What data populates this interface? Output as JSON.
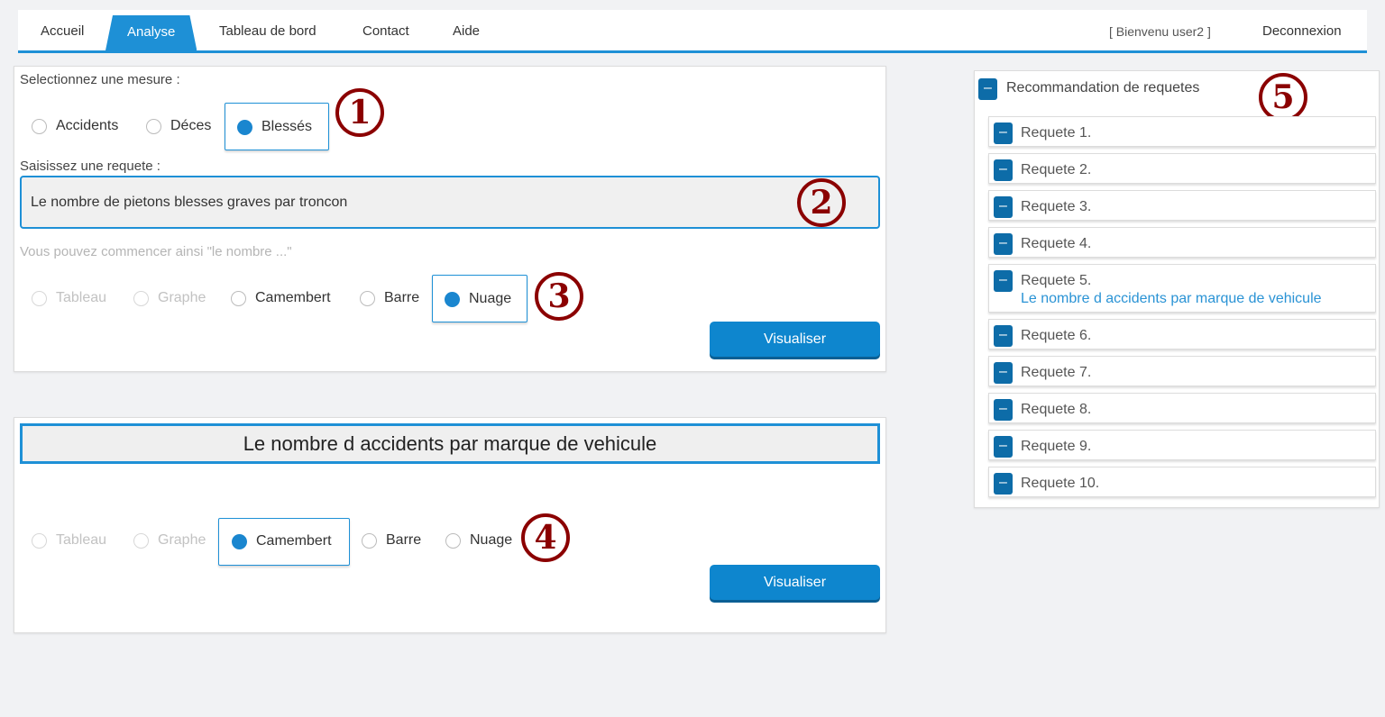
{
  "nav": {
    "tabs": [
      {
        "label": "Accueil",
        "active": false
      },
      {
        "label": "Analyse",
        "active": true
      },
      {
        "label": "Tableau de bord",
        "active": false
      },
      {
        "label": "Contact",
        "active": false
      },
      {
        "label": "Aide",
        "active": false
      }
    ],
    "user_greeting": "[ Bienvenu user2 ]",
    "logout_label": "Deconnexion"
  },
  "query_panel": {
    "measure_label": "Selectionnez une mesure :",
    "measures": [
      {
        "label": "Accidents",
        "selected": false
      },
      {
        "label": "Déces",
        "selected": false
      },
      {
        "label": "Blessés",
        "selected": true
      }
    ],
    "request_label": "Saisissez une requete :",
    "request_value": "Le nombre de pietons blesses graves par troncon",
    "hint": "Vous pouvez commencer ainsi \"le nombre ...\"",
    "viz_types": [
      {
        "label": "Tableau",
        "selected": false,
        "disabled": true
      },
      {
        "label": "Graphe",
        "selected": false,
        "disabled": true
      },
      {
        "label": "Camembert",
        "selected": false,
        "disabled": false
      },
      {
        "label": "Barre",
        "selected": false,
        "disabled": false
      },
      {
        "label": "Nuage",
        "selected": true,
        "disabled": false
      }
    ],
    "visualize_label": "Visualiser"
  },
  "result_panel": {
    "title": "Le nombre d accidents par marque de vehicule",
    "viz_types": [
      {
        "label": "Tableau",
        "selected": false,
        "disabled": true
      },
      {
        "label": "Graphe",
        "selected": false,
        "disabled": true
      },
      {
        "label": "Camembert",
        "selected": true,
        "disabled": false
      },
      {
        "label": "Barre",
        "selected": false,
        "disabled": false
      },
      {
        "label": "Nuage",
        "selected": false,
        "disabled": false
      }
    ],
    "visualize_label": "Visualiser"
  },
  "recommendations": {
    "toggle_symbol": "–",
    "title": "Recommandation de requetes",
    "items": [
      {
        "label": "Requete 1.",
        "query": ""
      },
      {
        "label": "Requete 2.",
        "query": ""
      },
      {
        "label": "Requete 3.",
        "query": ""
      },
      {
        "label": "Requete 4.",
        "query": ""
      },
      {
        "label": "Requete 5.",
        "query": "Le nombre d accidents par marque de vehicule"
      },
      {
        "label": "Requete 6.",
        "query": ""
      },
      {
        "label": "Requete 7.",
        "query": ""
      },
      {
        "label": "Requete 8.",
        "query": ""
      },
      {
        "label": "Requete 9.",
        "query": ""
      },
      {
        "label": "Requete 10.",
        "query": ""
      }
    ]
  },
  "markers": [
    "1",
    "2",
    "3",
    "4",
    "5"
  ],
  "colors": {
    "accent": "#1e90d6",
    "button": "#0e86ce",
    "marker": "#8b0000",
    "link": "#2a93d5",
    "background": "#f1f2f4"
  }
}
